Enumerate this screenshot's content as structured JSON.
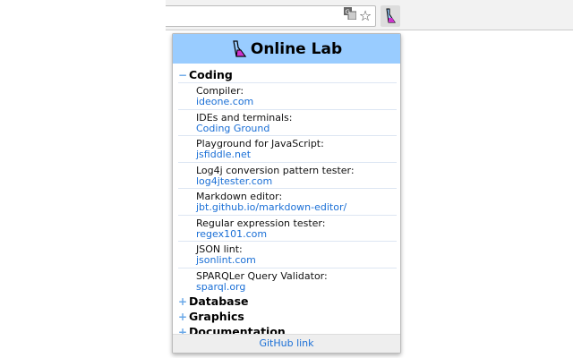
{
  "browser": {
    "translate_icon": "translate-icon",
    "bookmark_icon": "star-icon",
    "extension_icon": "flask-icon"
  },
  "popup": {
    "title": "Online Lab",
    "sections": [
      {
        "name": "Coding",
        "sign": "−",
        "expanded": true,
        "items": [
          {
            "label": "Compiler:",
            "link": "ideone.com"
          },
          {
            "label": "IDEs and terminals:",
            "link": "Coding Ground"
          },
          {
            "label": "Playground for JavaScript:",
            "link": "jsfiddle.net"
          },
          {
            "label": "Log4j conversion pattern tester:",
            "link": "log4jtester.com"
          },
          {
            "label": "Markdown editor:",
            "link": "jbt.github.io/markdown-editor/"
          },
          {
            "label": "Regular expression tester:",
            "link": "regex101.com"
          },
          {
            "label": "JSON lint:",
            "link": "jsonlint.com"
          },
          {
            "label": "SPARQLer Query Validator:",
            "link": "sparql.org"
          }
        ]
      },
      {
        "name": "Database",
        "sign": "+",
        "expanded": false
      },
      {
        "name": "Graphics",
        "sign": "+",
        "expanded": false
      },
      {
        "name": "Documentation",
        "sign": "+",
        "expanded": false
      }
    ],
    "footer_link": "GitHub link"
  },
  "colors": {
    "header": "#99ccff",
    "link": "#1a6fd6",
    "flask": "#cc33cc"
  }
}
